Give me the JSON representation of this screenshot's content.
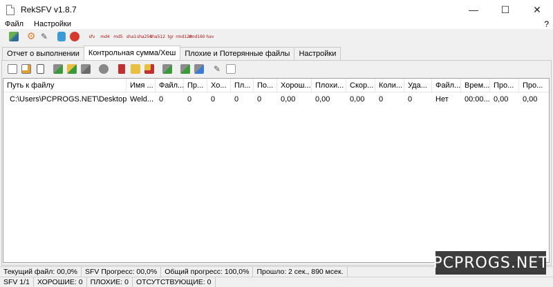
{
  "window": {
    "title": "RekSFV v1.8.7",
    "minimize": "—",
    "maximize": "☐",
    "close": "✕"
  },
  "menu": {
    "items": [
      "Файл",
      "Настройки"
    ],
    "help": "?"
  },
  "toolbar": {
    "hash_buttons": [
      "sfv",
      "md4",
      "md5",
      "sha1",
      "sha256",
      "sha512",
      "tgr",
      "rmd128",
      "rmd160",
      "hav"
    ]
  },
  "tabs": [
    "Отчет о выполнении",
    "Контрольная сумма/Хеш",
    "Плохие и Потерянные файлы",
    "Настройки"
  ],
  "table": {
    "columns": [
      "Путь к файлу",
      "Имя ...",
      "Файл...",
      "Пр...",
      "Хо...",
      "Пл...",
      "По...",
      "Хорош...",
      "Плохи...",
      "Скор...",
      "Коли...",
      "Уда...",
      "Файл...",
      "Врем...",
      "Про...",
      "Про..."
    ],
    "rows": [
      [
        "C:\\Users\\PCPROGS.NET\\Desktop\\",
        "Weld...",
        "0",
        "0",
        "0",
        "0",
        "0",
        "0,00",
        "0,00",
        "0,00",
        "0",
        "0",
        "Нет",
        "00:00...",
        "0,00",
        "0,00"
      ]
    ]
  },
  "status_line1": [
    "Текущий файл: 00,0%",
    "SFV Прогресс: 00,0%",
    "Общий прогресс: 100,0%",
    "Прошло: 2 сек., 890 мсек."
  ],
  "status_line2": [
    "SFV 1/1",
    "ХОРОШИЕ: 0",
    "ПЛОХИЕ: 0",
    "ОТСУТСТВУЮЩИЕ: 0"
  ],
  "watermark": "PCPROGS.NET",
  "colors": {
    "hash_label": "#b01010",
    "watermark_bg": "#1e1e1e"
  }
}
